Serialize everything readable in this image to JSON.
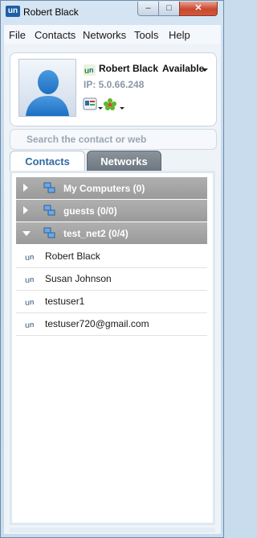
{
  "window": {
    "title": "Robert Black",
    "app_icon_text": "un",
    "controls": {
      "minimize": "–",
      "maximize": "□",
      "close": "✕"
    }
  },
  "menu": {
    "items": [
      "File",
      "Contacts",
      "Networks",
      "Tools",
      "Help"
    ]
  },
  "profile": {
    "name": "Robert Black",
    "presence": "Available",
    "ip": "IP: 5.0.66.248",
    "accent": "#2f6aa3",
    "tool_icons": [
      "vcard-icon",
      "flower-plugin-icon"
    ]
  },
  "search": {
    "placeholder": "Search the contact or web",
    "value": ""
  },
  "tabs": [
    {
      "label": "Contacts",
      "active": true
    },
    {
      "label": "Networks",
      "active": false
    }
  ],
  "groups": [
    {
      "label": "My Computers (0)",
      "expanded": false
    },
    {
      "label": "guests (0/0)",
      "expanded": false
    },
    {
      "label": "test_net2 (0/4)",
      "expanded": true
    }
  ],
  "contacts": [
    {
      "name": "Robert Black"
    },
    {
      "name": "Susan Johnson"
    },
    {
      "name": "testuser1"
    },
    {
      "name": "testuser720@gmail.com"
    }
  ]
}
